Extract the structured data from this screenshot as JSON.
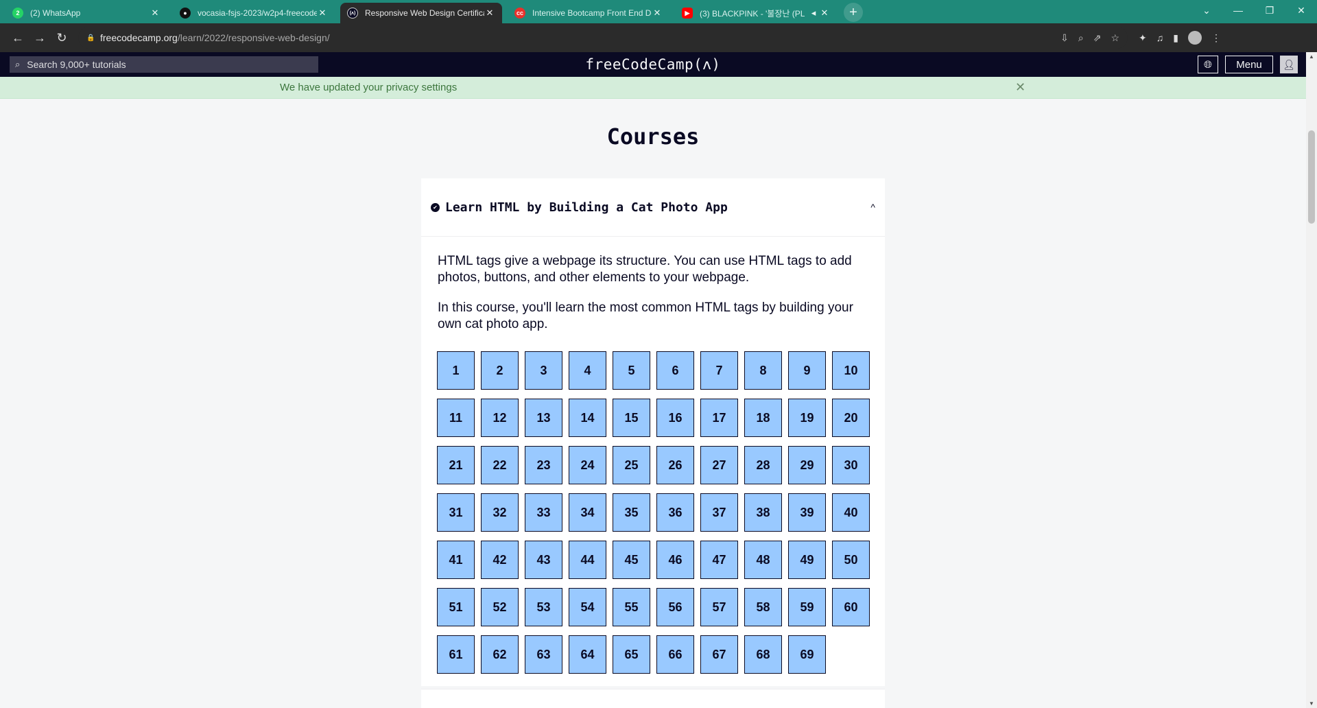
{
  "browser": {
    "tabs": [
      {
        "title": "(2) WhatsApp",
        "icon": "whatsapp-icon",
        "icon_color": "#25d366",
        "icon_text": "2"
      },
      {
        "title": "vocasia-fsjs-2023/w2p4-freecode",
        "icon": "github-icon",
        "icon_color": "#111111",
        "icon_text": "●"
      },
      {
        "title": "Responsive Web Design Certificat",
        "icon": "freecodecamp-icon",
        "icon_color": "#0a0a23",
        "icon_text": "(ʌ)"
      },
      {
        "title": "Intensive Bootcamp Front End De",
        "icon": "codepolitan-icon",
        "icon_color": "#e8322c",
        "icon_text": "cc"
      },
      {
        "title": "(3) BLACKPINK - '불장난 (PL",
        "icon": "youtube-icon",
        "icon_color": "#ff0000",
        "icon_text": "▶"
      }
    ],
    "address": {
      "domain": "freecodecamp.org",
      "path": "/learn/2022/responsive-web-design/"
    }
  },
  "nav": {
    "search_placeholder": "Search 9,000+ tutorials",
    "logo": "freeCodeCamp(ʌ)",
    "menu_label": "Menu"
  },
  "banner": {
    "message": "We have updated your privacy settings"
  },
  "page": {
    "heading": "Courses",
    "course": {
      "title": "Learn HTML by Building a Cat Photo App",
      "completed": true,
      "expanded": true,
      "description": [
        "HTML tags give a webpage its structure. You can use HTML tags to add photos, buttons, and other elements to your webpage.",
        "In this course, you'll learn the most common HTML tags by building your own cat photo app."
      ],
      "steps_count": 69
    }
  },
  "colors": {
    "step_bg": "#99c9ff",
    "nav_bg": "#0a0a23",
    "banner_bg": "#d4edda"
  }
}
